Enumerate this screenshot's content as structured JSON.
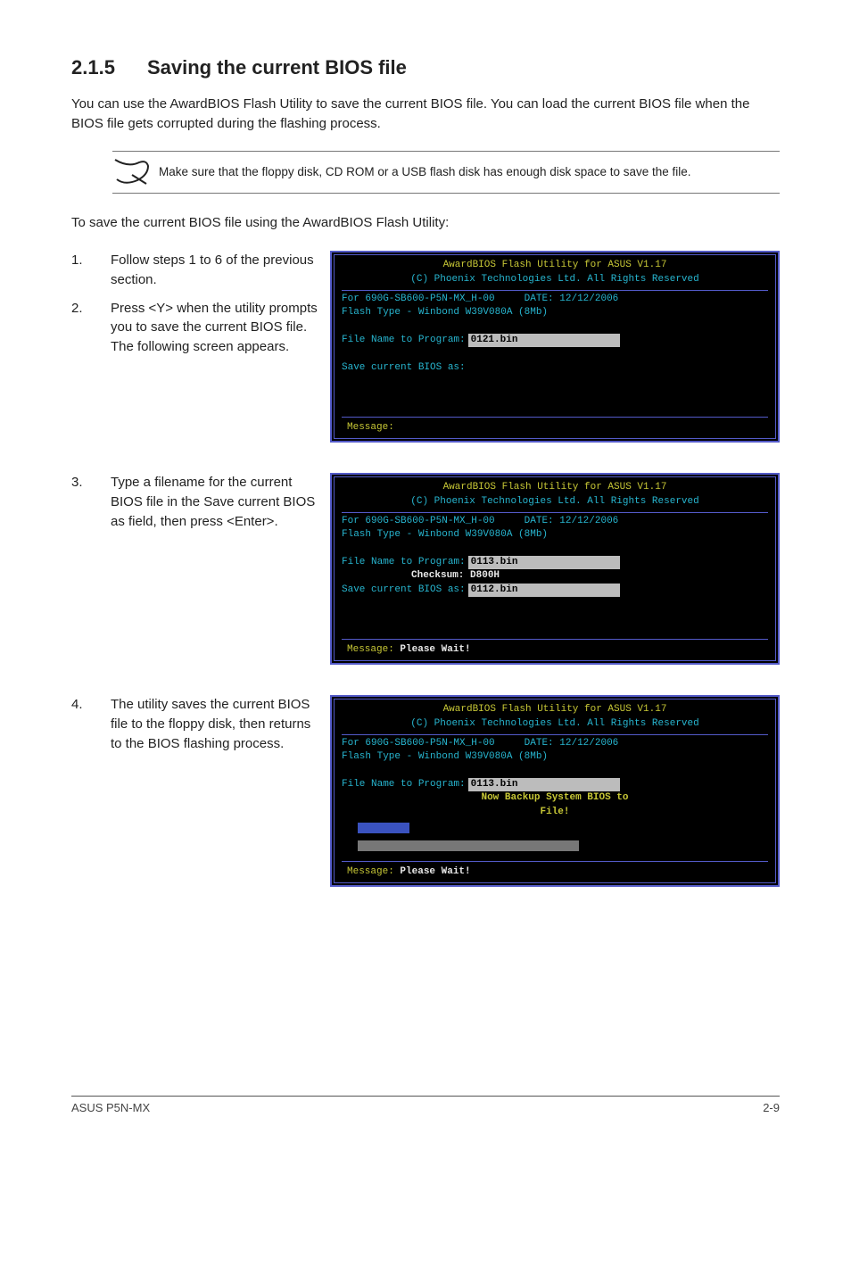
{
  "section": {
    "number": "2.1.5",
    "title": "Saving the current BIOS file"
  },
  "intro": "You can use the AwardBIOS Flash Utility to save the current BIOS file. You can load the current BIOS file when the BIOS file gets corrupted during the flashing process.",
  "note": "Make sure that the floppy disk, CD ROM or a USB flash disk has enough disk space to save the file.",
  "lead": "To save the current BIOS file using the AwardBIOS Flash Utility:",
  "steps": {
    "s1": "Follow steps 1 to 6 of the previous section.",
    "s2": "Press <Y> when the utility prompts you to save the current BIOS file. The following screen appears.",
    "s3": "Type a filename for the current BIOS file in the Save current BIOS as field, then press <Enter>.",
    "s4": "The utility saves the current BIOS file to the floppy disk, then returns to the BIOS flashing process."
  },
  "term_common": {
    "head": "AwardBIOS Flash Utility for ASUS V1.17",
    "sub": "(C) Phoenix Technologies Ltd. All Rights Reserved",
    "line1a": "For 690G-SB600-P5N-MX_H-00",
    "line1b": "DATE: 12/12/2006",
    "line2": "Flash Type - Winbond W39V080A (8Mb)",
    "file_label": "File Name to Program:",
    "save_label": "Save current BIOS as:",
    "msg_label": "Message:"
  },
  "shot1": {
    "file": "0121.bin",
    "save": ""
  },
  "shot2": {
    "file": "0113.bin",
    "checksum": "Checksum: D800H",
    "save": "0112.bin",
    "msg": "Please Wait!"
  },
  "shot3": {
    "file": "0113.bin",
    "banner1": "Now Backup System BIOS to",
    "banner2": "File!",
    "msg": "Please Wait!"
  },
  "footer": {
    "left": "ASUS P5N-MX",
    "right": "2-9"
  }
}
